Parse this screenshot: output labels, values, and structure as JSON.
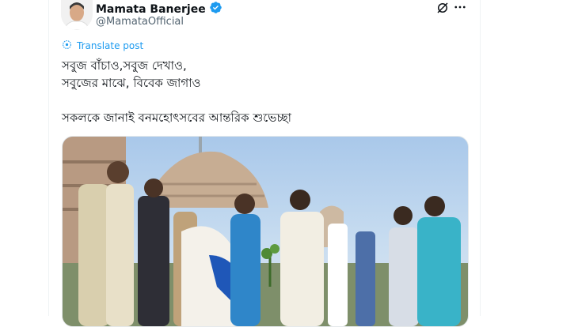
{
  "tweet": {
    "author_name": "Mamata Banerjee",
    "author_handle": "@MamataOfficial",
    "translate_label": "Translate post",
    "lines": [
      "সবুজ বাঁচাও,সবুজ দেখাও,",
      "সবুজের মাঝে, বিবেক জাগাও",
      "",
      "সকলকে জানাই বনমহোৎসবের আন্তরিক শুভেচ্ছা"
    ],
    "more_icon": "more-horizontal-icon",
    "grok_icon": "grok-icon",
    "verified_icon": "verified-badge-icon"
  },
  "colors": {
    "accent": "#1d9bf0",
    "text": "#0f1419",
    "muted": "#536471"
  }
}
